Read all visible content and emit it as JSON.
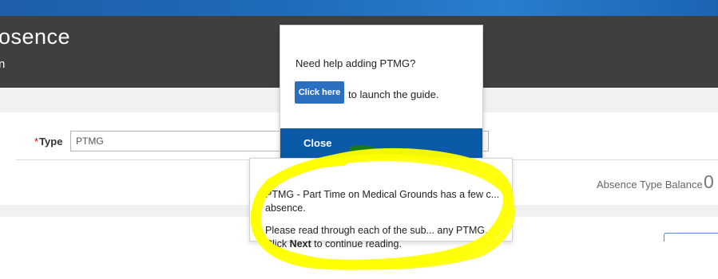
{
  "header": {
    "title": "osence",
    "subtitle": "n"
  },
  "form": {
    "type_required_marker": "*",
    "type_label": "Type",
    "type_value": "PTMG"
  },
  "balance": {
    "label": "Absence Type Balance",
    "value": "0"
  },
  "help_popup": {
    "question": "Need help adding PTMG?",
    "click_here_label": "Click here",
    "launch_text": "to launch the guide.",
    "close_label": "Close"
  },
  "guide_popup": {
    "paragraph1": "PTMG - Part Time on Medical Grounds has a few c... absence.",
    "paragraph2_prefix": "Please read through each of the sub... any PTMG. Click ",
    "next_label": "Next",
    "paragraph2_suffix": " to continue reading."
  },
  "annotation": {
    "highlight_color": "#ffff00"
  }
}
